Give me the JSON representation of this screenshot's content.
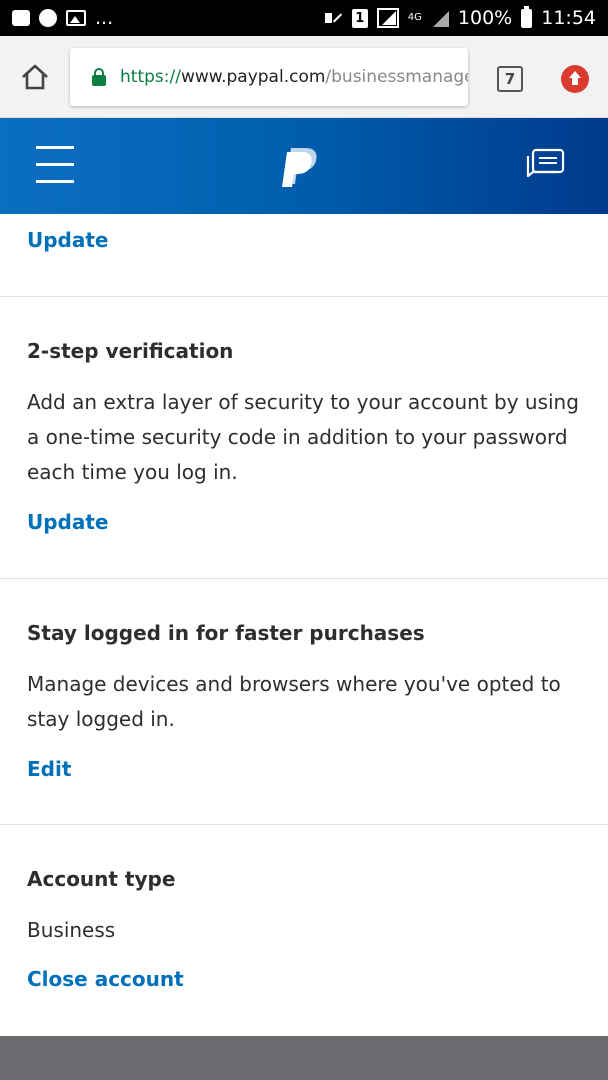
{
  "status_bar": {
    "left_more": "...",
    "network_label": "4G",
    "sim_label": "1",
    "battery": "100%",
    "time": "11:54"
  },
  "browser": {
    "url_protocol": "https://",
    "url_host": "www.paypal.com",
    "url_path": "/businessmanage/",
    "tab_count": "7",
    "icons": [
      "home-icon",
      "lock-icon",
      "tabs-icon",
      "update-icon"
    ]
  },
  "header": {
    "icons": [
      "hamburger-menu-icon",
      "paypal-logo",
      "messages-icon"
    ],
    "brand_color": "#0060b0"
  },
  "sections": {
    "top": {
      "link": "Update"
    },
    "two_step": {
      "title": "2-step verification",
      "line1": "Add an extra layer of security to your account by using",
      "line2": "a one-time security code in addition to your password",
      "line3": "each time you log in.",
      "link": "Update"
    },
    "stay_logged": {
      "title": "Stay logged in for faster purchases",
      "line1": "Manage devices and browsers where you've opted to",
      "line2": "stay logged in.",
      "link": "Edit"
    },
    "account_type": {
      "title": "Account type",
      "value": "Business",
      "link": "Close account"
    }
  },
  "colors": {
    "link": "#0070ba",
    "text": "#2c2e2f",
    "secure_green": "#0b8043"
  }
}
